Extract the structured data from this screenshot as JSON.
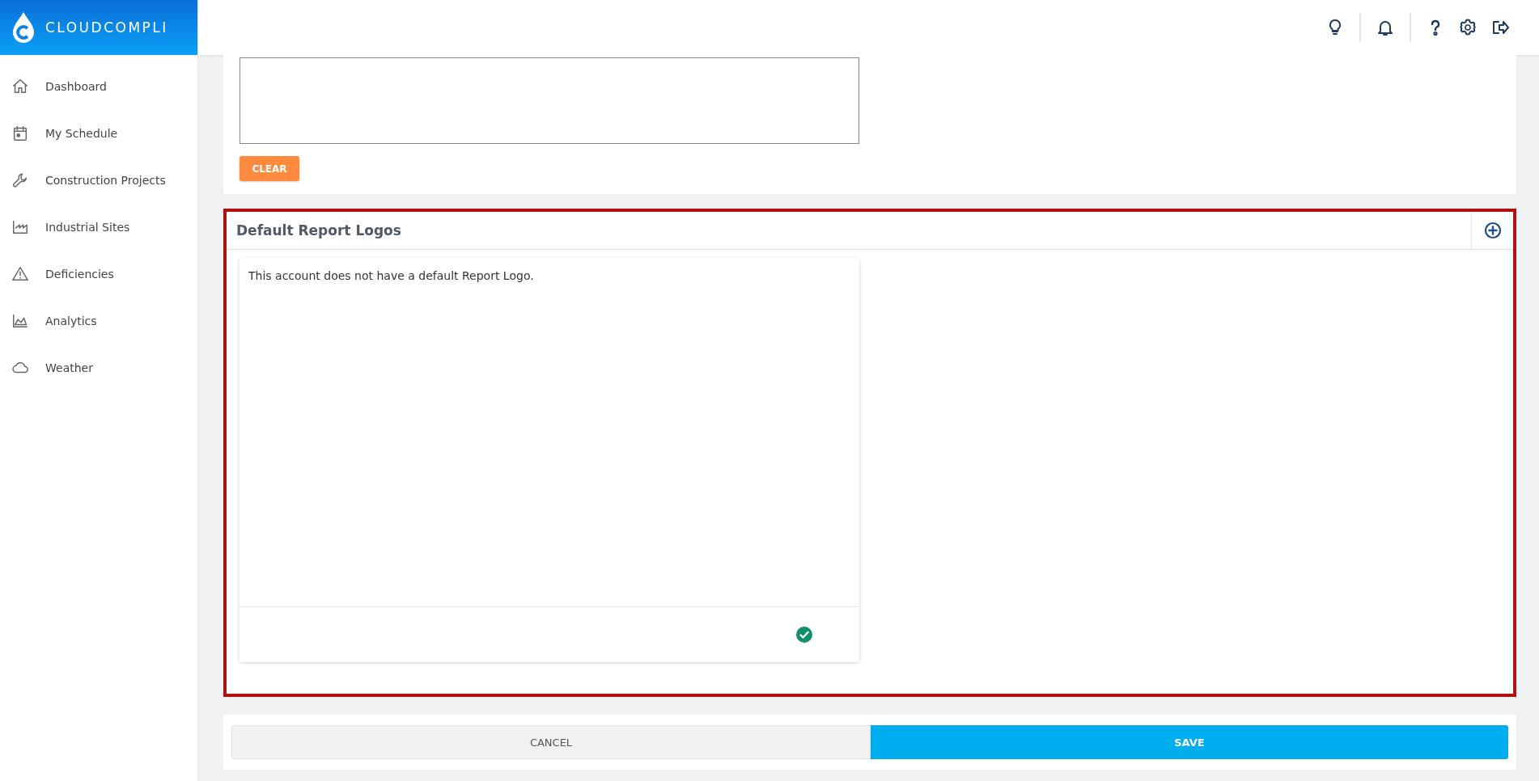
{
  "sidebar": {
    "logo": "CLOUDCOMPLI",
    "items": [
      {
        "label": "Dashboard",
        "kind": "home"
      },
      {
        "label": "My Schedule",
        "kind": "calendar"
      },
      {
        "label": "Construction Projects",
        "kind": "wrench"
      },
      {
        "label": "Industrial Sites",
        "kind": "factory"
      },
      {
        "label": "Deficiencies",
        "kind": "warning"
      },
      {
        "label": "Analytics",
        "kind": "chart"
      },
      {
        "label": "Weather",
        "kind": "cloud"
      }
    ]
  },
  "signature_card": {
    "clear_button": "CLEAR"
  },
  "report_logos": {
    "title": "Default Report Logos",
    "logo_card": {
      "message": "This account does not have a default Report Logo."
    }
  },
  "footer": {
    "cancel": "CANCEL",
    "save": "SAVE"
  }
}
